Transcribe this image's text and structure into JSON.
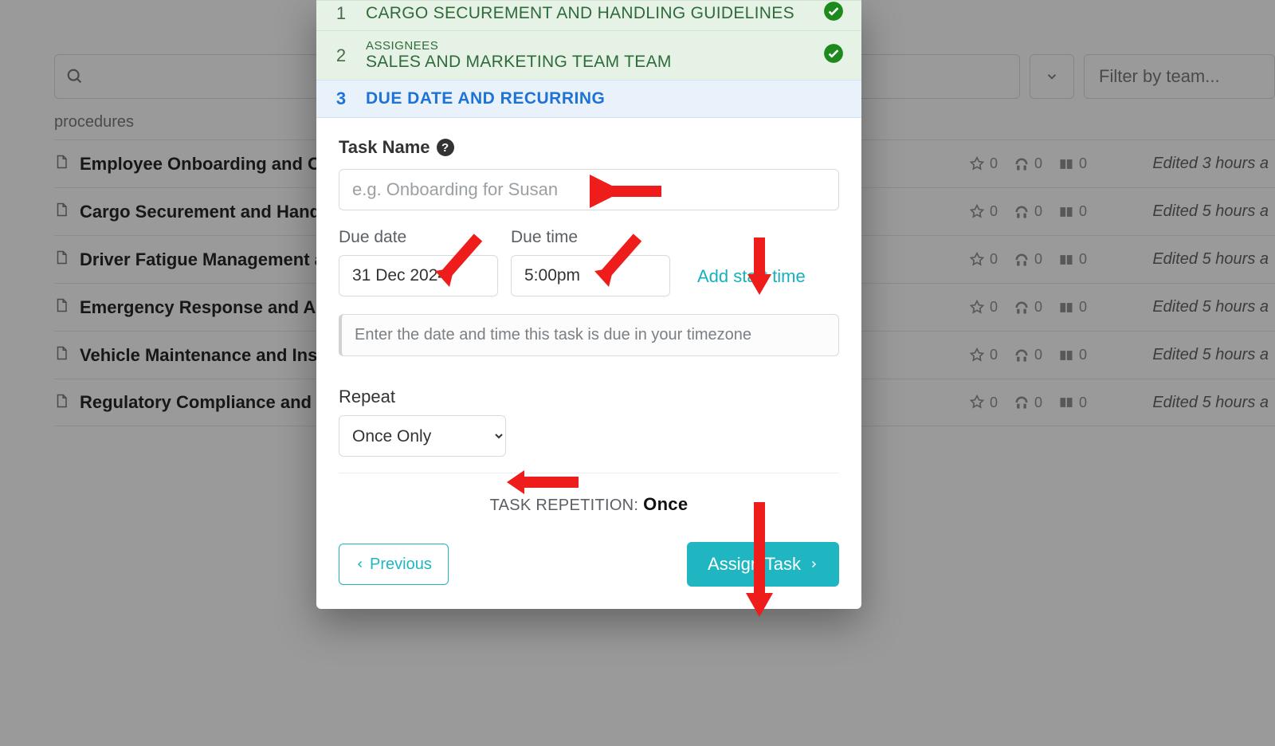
{
  "filters": {
    "team_placeholder": "Filter by team..."
  },
  "breadcrumb": "procedures",
  "list": [
    {
      "title": "Employee Onboarding and Orie",
      "stat": "0",
      "edited": "Edited 3 hours a"
    },
    {
      "title": "Cargo Securement and Handlin",
      "stat": "0",
      "edited": "Edited 5 hours a"
    },
    {
      "title": "Driver Fatigue Management an",
      "stat": "0",
      "edited": "Edited 5 hours a"
    },
    {
      "title": "Emergency Response and Accid",
      "stat": "0",
      "edited": "Edited 5 hours a"
    },
    {
      "title": "Vehicle Maintenance and Inspe",
      "stat": "0",
      "edited": "Edited 5 hours a"
    },
    {
      "title": "Regulatory Compliance and Do",
      "stat": "0",
      "edited": "Edited 5 hours a"
    }
  ],
  "modal": {
    "steps": {
      "s1": {
        "num": "1",
        "title": "CARGO SECUREMENT AND HANDLING GUIDELINES"
      },
      "s2": {
        "num": "2",
        "eyebrow": "ASSIGNEES",
        "title": "SALES AND MARKETING TEAM TEAM"
      },
      "s3": {
        "num": "3",
        "title": "DUE DATE AND RECURRING"
      }
    },
    "task_name_label": "Task Name",
    "task_name_placeholder": "e.g. Onboarding for Susan",
    "due_date_label": "Due date",
    "due_date_value": "31 Dec 2024",
    "due_time_label": "Due time",
    "due_time_value": "5:00pm",
    "add_start_time": "Add start time",
    "timezone_hint": "Enter the date and time this task is due in your timezone",
    "repeat_label": "Repeat",
    "repeat_value": "Once Only",
    "repetition_label": "TASK REPETITION:",
    "repetition_value": "Once",
    "previous_label": "Previous",
    "assign_label": "Assign Task"
  }
}
